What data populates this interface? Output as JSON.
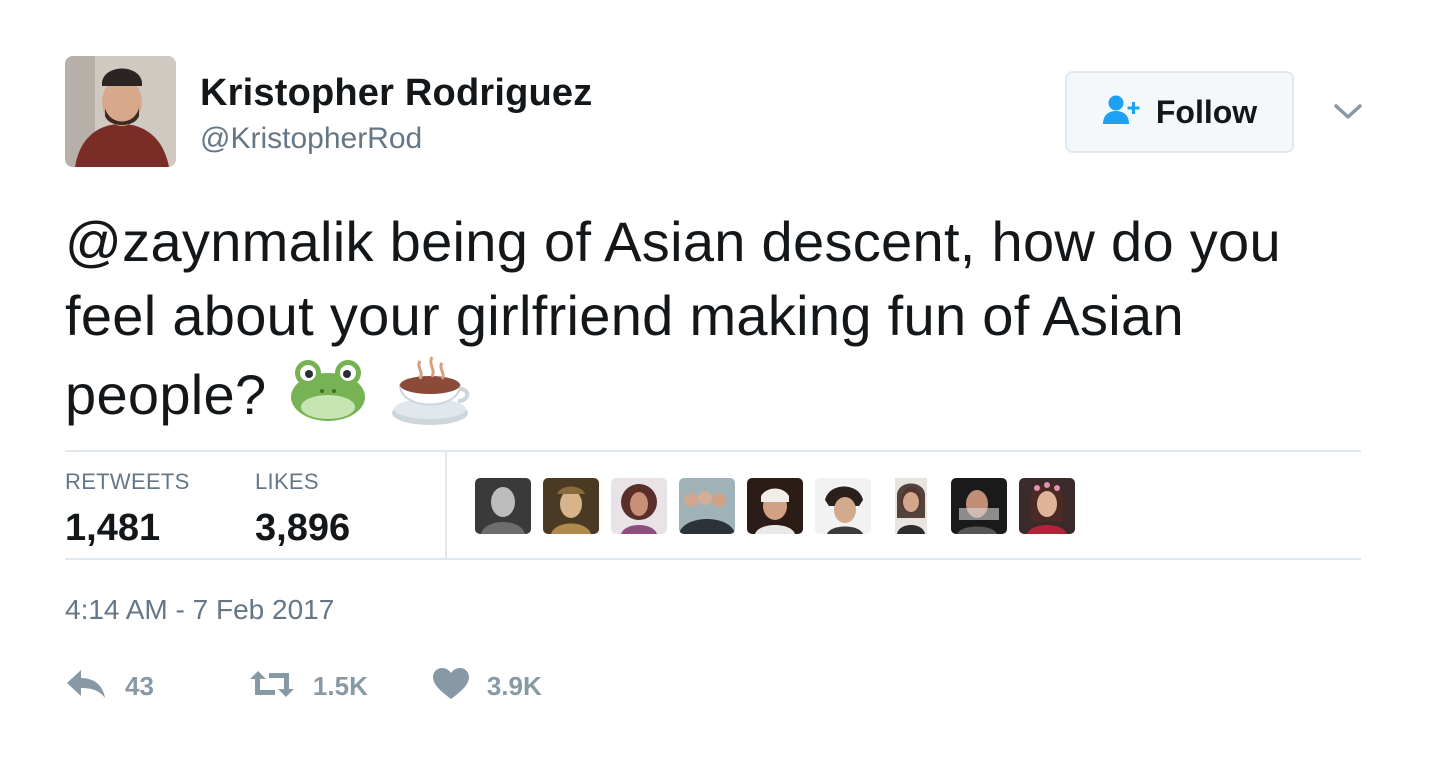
{
  "author": {
    "name": "Kristopher Rodriguez",
    "handle": "@KristopherRod"
  },
  "follow_button": {
    "label": "Follow",
    "icon": "add-user-icon"
  },
  "menu_icon": "chevron-down-icon",
  "tweet": {
    "text": "@zaynmalik being of Asian descent, how do you feel about your girlfriend making fun of Asian people?",
    "emojis": [
      "frog-face-emoji",
      "hot-beverage-emoji"
    ]
  },
  "stats": {
    "retweets_label": "RETWEETS",
    "retweets_value": "1,481",
    "likes_label": "LIKES",
    "likes_value": "3,896"
  },
  "timestamp": "4:14 AM - 7 Feb 2017",
  "actions": {
    "reply_count": "43",
    "retweet_count": "1.5K",
    "like_count": "3.9K"
  },
  "colors": {
    "text": "#14171a",
    "secondary": "#657786",
    "action_gray": "#8899a6",
    "follow_icon": "#1da1f2",
    "border": "#e1e8ed"
  }
}
